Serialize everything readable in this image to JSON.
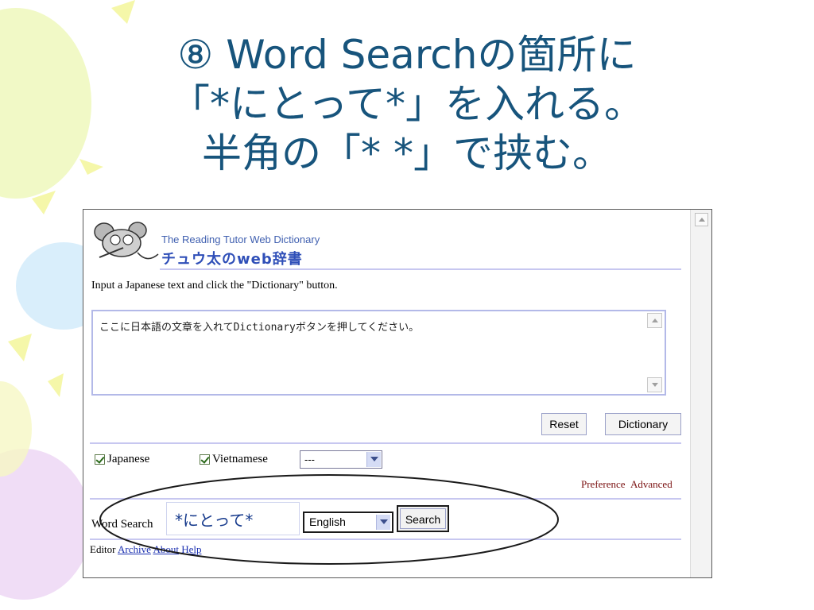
{
  "slide": {
    "title_lines": [
      "⑧  Word Searchの箇所に",
      "「*にとって*」を入れる。",
      "半角の「*  *」で挟む。"
    ]
  },
  "app": {
    "logo_subtitle": "The Reading Tutor Web Dictionary",
    "logo_title": "チュウ太のweb辞書",
    "instruction": "Input a Japanese text and click the \"Dictionary\" button.",
    "textbox_value": "ここに日本語の文章を入れてDictionaryボタンを押してください。",
    "reset_label": "Reset",
    "dictionary_label": "Dictionary",
    "checkboxes": [
      {
        "label": "Japanese",
        "checked": true
      },
      {
        "label": "Vietnamese",
        "checked": true
      }
    ],
    "language_select_value": "---",
    "preference_label": "Preference",
    "advanced_label": "Advanced",
    "word_search_label": "Word Search",
    "word_search_value": "*にとって*",
    "word_search_language": "English",
    "search_label": "Search",
    "footer": {
      "editor": "Editor",
      "archive": "Archive",
      "about": "About",
      "help": "Help"
    }
  },
  "colors": {
    "title": "#17547c",
    "link": "#1a2fb0",
    "rule": "#c7c7f0"
  }
}
